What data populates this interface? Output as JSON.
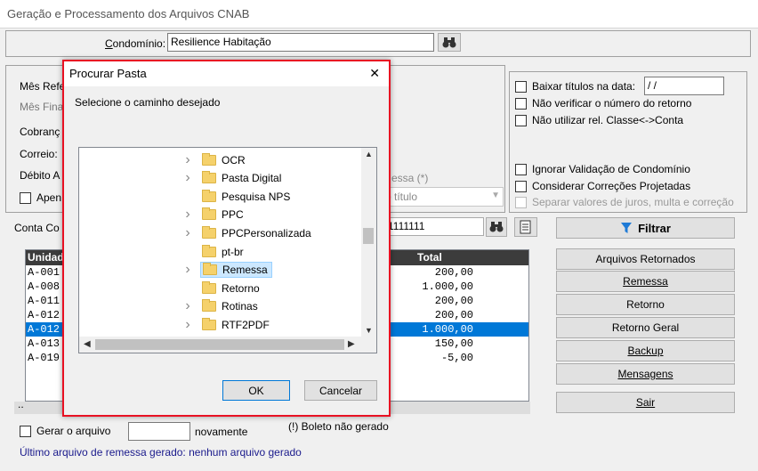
{
  "window": {
    "title": "Geração e Processamento dos Arquivos CNAB"
  },
  "condominio": {
    "label": "Condomínio:",
    "value": "Resilience Habitação"
  },
  "left_panel": {
    "mes_ref_label": "Mês Refe",
    "mes_final_label": "Mês Fina",
    "cobranca_label": "Cobranç",
    "correio_label": "Correio:",
    "debito_label": "Débito A",
    "apenas_label": "Apen"
  },
  "right_panel": {
    "baixar_label": "Baixar títulos na data:",
    "baixar_date": " / /",
    "nao_verificar_label": "Não verificar o número do retorno",
    "nao_utilizar_label": "Não utilizar rel. Classe<->Conta",
    "ignorar_label": "Ignorar Validação de Condomínio",
    "considerar_label": "Considerar Correções Projetadas",
    "separar_label": "Separar valores de juros, multa e correção"
  },
  "middle": {
    "remessa_hint": "essa (*)",
    "titulo_select": "o título"
  },
  "conta": {
    "label": "Conta Co",
    "value": "1111111"
  },
  "filtrar_button": "Filtrar",
  "table": {
    "headers": {
      "unidade": "Unidad",
      "total": "Total"
    },
    "rows": [
      {
        "unidade": "A-001",
        "total": "200,00",
        "selected": false
      },
      {
        "unidade": "A-008",
        "total": "1.000,00",
        "selected": false
      },
      {
        "unidade": "A-011",
        "total": "200,00",
        "selected": false
      },
      {
        "unidade": "A-012",
        "total": "200,00",
        "selected": false
      },
      {
        "unidade": "A-012",
        "total": "1.000,00",
        "selected": true
      },
      {
        "unidade": "A-013",
        "total": "150,00",
        "selected": false
      },
      {
        "unidade": "A-019",
        "total": "-5,00",
        "selected": false
      }
    ],
    "footer_dots": ".."
  },
  "actions": {
    "arquivos_retornados": "Arquivos Retornados",
    "remessa": "Remessa",
    "retorno": "Retorno",
    "retorno_geral": "Retorno Geral",
    "backup": "Backup",
    "mensagens": "Mensagens",
    "sair": "Sair"
  },
  "bottom": {
    "gerar_label": "Gerar o arquivo",
    "novamente_label": "novamente",
    "boleto_msg": "(!) Boleto não gerado",
    "ultimo_label": "Último arquivo de remessa gerado: nenhum arquivo gerado"
  },
  "dialog": {
    "title": "Procurar Pasta",
    "close": "✕",
    "prompt": "Selecione o caminho desejado",
    "folders": [
      {
        "name": "OCR",
        "expandable": true,
        "selected": false
      },
      {
        "name": "Pasta Digital",
        "expandable": true,
        "selected": false
      },
      {
        "name": "Pesquisa NPS",
        "expandable": false,
        "selected": false
      },
      {
        "name": "PPC",
        "expandable": true,
        "selected": false
      },
      {
        "name": "PPCPersonalizada",
        "expandable": true,
        "selected": false
      },
      {
        "name": "pt-br",
        "expandable": false,
        "selected": false
      },
      {
        "name": "Remessa",
        "expandable": true,
        "selected": true
      },
      {
        "name": "Retorno",
        "expandable": false,
        "selected": false
      },
      {
        "name": "Rotinas",
        "expandable": true,
        "selected": false
      },
      {
        "name": "RTF2PDF",
        "expandable": true,
        "selected": false
      }
    ],
    "ok_button": "OK",
    "cancel_button": "Cancelar"
  },
  "colors": {
    "accent_border": "#e81123",
    "selection": "#0078d7",
    "filter_icon": "#1e7ad6"
  }
}
